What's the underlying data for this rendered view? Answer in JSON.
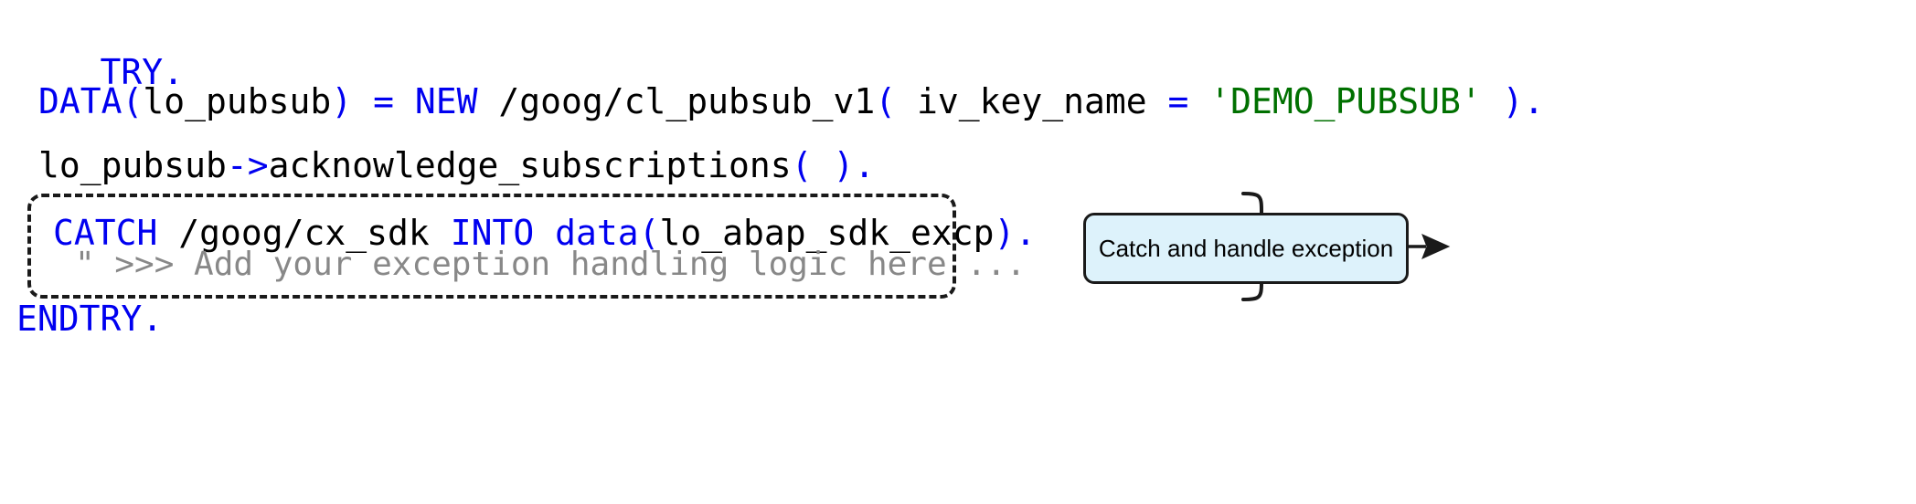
{
  "diagram": {
    "background_color": "#ffffff",
    "code": {
      "language": "ABAP",
      "font": "monospace",
      "colors": {
        "keyword": "#0000f0",
        "plain": "#000000",
        "string": "#007000",
        "comment": "#888888"
      },
      "lines": [
        {
          "id": "try",
          "tokens": [
            {
              "text": "TRY",
              "kind": "keyword"
            },
            {
              "text": ".",
              "kind": "keyword"
            }
          ],
          "plain_text": "TRY."
        },
        {
          "id": "data",
          "tokens": [
            {
              "text": "DATA",
              "kind": "keyword"
            },
            {
              "text": "(",
              "kind": "keyword"
            },
            {
              "text": "lo_pubsub",
              "kind": "plain"
            },
            {
              "text": ")",
              "kind": "keyword"
            },
            {
              "text": " ",
              "kind": "plain"
            },
            {
              "text": "=",
              "kind": "keyword"
            },
            {
              "text": " ",
              "kind": "plain"
            },
            {
              "text": "NEW",
              "kind": "keyword"
            },
            {
              "text": " /goog/cl_pubsub_v1",
              "kind": "plain"
            },
            {
              "text": "(",
              "kind": "keyword"
            },
            {
              "text": " iv_key_name ",
              "kind": "plain"
            },
            {
              "text": "=",
              "kind": "keyword"
            },
            {
              "text": " ",
              "kind": "plain"
            },
            {
              "text": "'DEMO_PUBSUB'",
              "kind": "string"
            },
            {
              "text": " ",
              "kind": "plain"
            },
            {
              "text": ")",
              "kind": "keyword"
            },
            {
              "text": ".",
              "kind": "keyword"
            }
          ],
          "plain_text": "DATA(lo_pubsub) = NEW /goog/cl_pubsub_v1( iv_key_name = 'DEMO_PUBSUB' )."
        },
        {
          "id": "ack",
          "tokens": [
            {
              "text": "lo_pubsub",
              "kind": "plain"
            },
            {
              "text": "->",
              "kind": "keyword"
            },
            {
              "text": "acknowledge_subscriptions",
              "kind": "plain"
            },
            {
              "text": "(",
              "kind": "keyword"
            },
            {
              "text": " ",
              "kind": "plain"
            },
            {
              "text": ")",
              "kind": "keyword"
            },
            {
              "text": ".",
              "kind": "keyword"
            }
          ],
          "plain_text": "lo_pubsub->acknowledge_subscriptions( )."
        },
        {
          "id": "catch",
          "tokens": [
            {
              "text": "CATCH",
              "kind": "keyword"
            },
            {
              "text": " /goog/cx_sdk ",
              "kind": "plain"
            },
            {
              "text": "INTO",
              "kind": "keyword"
            },
            {
              "text": " ",
              "kind": "plain"
            },
            {
              "text": "data",
              "kind": "keyword"
            },
            {
              "text": "(",
              "kind": "keyword"
            },
            {
              "text": "lo_abap_sdk_excp",
              "kind": "plain"
            },
            {
              "text": ")",
              "kind": "keyword"
            },
            {
              "text": ".",
              "kind": "keyword"
            }
          ],
          "plain_text": "CATCH /goog/cx_sdk INTO data(lo_abap_sdk_excp)."
        },
        {
          "id": "comment",
          "tokens": [
            {
              "text": "\" >>> Add your exception handling logic here ...",
              "kind": "comment"
            }
          ],
          "plain_text": "\" >>> Add your exception handling logic here ..."
        },
        {
          "id": "endtry",
          "tokens": [
            {
              "text": "ENDTRY",
              "kind": "keyword"
            },
            {
              "text": ".",
              "kind": "keyword"
            }
          ],
          "plain_text": "ENDTRY."
        }
      ]
    },
    "highlight": {
      "style": "dashed-rounded-rectangle",
      "color": "#1a1a1a",
      "encloses": [
        "catch",
        "comment"
      ]
    },
    "annotation": {
      "label": "Catch and handle exception",
      "fill_color": "#ddf2fb",
      "border_color": "#1a1a1a",
      "connector": "curly-brace-with-arrow"
    }
  }
}
